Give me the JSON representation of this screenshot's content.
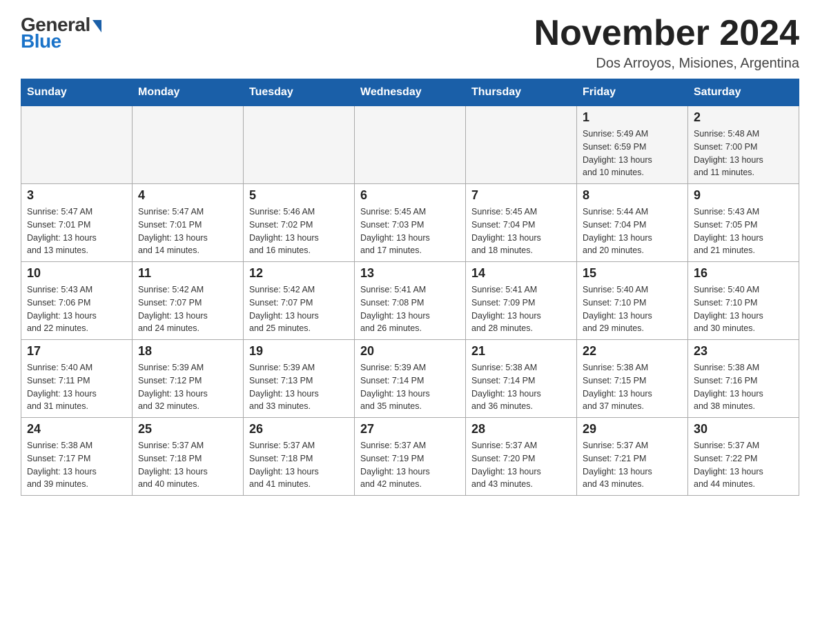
{
  "logo": {
    "general": "General",
    "blue": "Blue"
  },
  "header": {
    "month_year": "November 2024",
    "location": "Dos Arroyos, Misiones, Argentina"
  },
  "days_of_week": [
    "Sunday",
    "Monday",
    "Tuesday",
    "Wednesday",
    "Thursday",
    "Friday",
    "Saturday"
  ],
  "weeks": [
    {
      "days": [
        {
          "number": "",
          "info": ""
        },
        {
          "number": "",
          "info": ""
        },
        {
          "number": "",
          "info": ""
        },
        {
          "number": "",
          "info": ""
        },
        {
          "number": "",
          "info": ""
        },
        {
          "number": "1",
          "info": "Sunrise: 5:49 AM\nSunset: 6:59 PM\nDaylight: 13 hours\nand 10 minutes."
        },
        {
          "number": "2",
          "info": "Sunrise: 5:48 AM\nSunset: 7:00 PM\nDaylight: 13 hours\nand 11 minutes."
        }
      ]
    },
    {
      "days": [
        {
          "number": "3",
          "info": "Sunrise: 5:47 AM\nSunset: 7:01 PM\nDaylight: 13 hours\nand 13 minutes."
        },
        {
          "number": "4",
          "info": "Sunrise: 5:47 AM\nSunset: 7:01 PM\nDaylight: 13 hours\nand 14 minutes."
        },
        {
          "number": "5",
          "info": "Sunrise: 5:46 AM\nSunset: 7:02 PM\nDaylight: 13 hours\nand 16 minutes."
        },
        {
          "number": "6",
          "info": "Sunrise: 5:45 AM\nSunset: 7:03 PM\nDaylight: 13 hours\nand 17 minutes."
        },
        {
          "number": "7",
          "info": "Sunrise: 5:45 AM\nSunset: 7:04 PM\nDaylight: 13 hours\nand 18 minutes."
        },
        {
          "number": "8",
          "info": "Sunrise: 5:44 AM\nSunset: 7:04 PM\nDaylight: 13 hours\nand 20 minutes."
        },
        {
          "number": "9",
          "info": "Sunrise: 5:43 AM\nSunset: 7:05 PM\nDaylight: 13 hours\nand 21 minutes."
        }
      ]
    },
    {
      "days": [
        {
          "number": "10",
          "info": "Sunrise: 5:43 AM\nSunset: 7:06 PM\nDaylight: 13 hours\nand 22 minutes."
        },
        {
          "number": "11",
          "info": "Sunrise: 5:42 AM\nSunset: 7:07 PM\nDaylight: 13 hours\nand 24 minutes."
        },
        {
          "number": "12",
          "info": "Sunrise: 5:42 AM\nSunset: 7:07 PM\nDaylight: 13 hours\nand 25 minutes."
        },
        {
          "number": "13",
          "info": "Sunrise: 5:41 AM\nSunset: 7:08 PM\nDaylight: 13 hours\nand 26 minutes."
        },
        {
          "number": "14",
          "info": "Sunrise: 5:41 AM\nSunset: 7:09 PM\nDaylight: 13 hours\nand 28 minutes."
        },
        {
          "number": "15",
          "info": "Sunrise: 5:40 AM\nSunset: 7:10 PM\nDaylight: 13 hours\nand 29 minutes."
        },
        {
          "number": "16",
          "info": "Sunrise: 5:40 AM\nSunset: 7:10 PM\nDaylight: 13 hours\nand 30 minutes."
        }
      ]
    },
    {
      "days": [
        {
          "number": "17",
          "info": "Sunrise: 5:40 AM\nSunset: 7:11 PM\nDaylight: 13 hours\nand 31 minutes."
        },
        {
          "number": "18",
          "info": "Sunrise: 5:39 AM\nSunset: 7:12 PM\nDaylight: 13 hours\nand 32 minutes."
        },
        {
          "number": "19",
          "info": "Sunrise: 5:39 AM\nSunset: 7:13 PM\nDaylight: 13 hours\nand 33 minutes."
        },
        {
          "number": "20",
          "info": "Sunrise: 5:39 AM\nSunset: 7:14 PM\nDaylight: 13 hours\nand 35 minutes."
        },
        {
          "number": "21",
          "info": "Sunrise: 5:38 AM\nSunset: 7:14 PM\nDaylight: 13 hours\nand 36 minutes."
        },
        {
          "number": "22",
          "info": "Sunrise: 5:38 AM\nSunset: 7:15 PM\nDaylight: 13 hours\nand 37 minutes."
        },
        {
          "number": "23",
          "info": "Sunrise: 5:38 AM\nSunset: 7:16 PM\nDaylight: 13 hours\nand 38 minutes."
        }
      ]
    },
    {
      "days": [
        {
          "number": "24",
          "info": "Sunrise: 5:38 AM\nSunset: 7:17 PM\nDaylight: 13 hours\nand 39 minutes."
        },
        {
          "number": "25",
          "info": "Sunrise: 5:37 AM\nSunset: 7:18 PM\nDaylight: 13 hours\nand 40 minutes."
        },
        {
          "number": "26",
          "info": "Sunrise: 5:37 AM\nSunset: 7:18 PM\nDaylight: 13 hours\nand 41 minutes."
        },
        {
          "number": "27",
          "info": "Sunrise: 5:37 AM\nSunset: 7:19 PM\nDaylight: 13 hours\nand 42 minutes."
        },
        {
          "number": "28",
          "info": "Sunrise: 5:37 AM\nSunset: 7:20 PM\nDaylight: 13 hours\nand 43 minutes."
        },
        {
          "number": "29",
          "info": "Sunrise: 5:37 AM\nSunset: 7:21 PM\nDaylight: 13 hours\nand 43 minutes."
        },
        {
          "number": "30",
          "info": "Sunrise: 5:37 AM\nSunset: 7:22 PM\nDaylight: 13 hours\nand 44 minutes."
        }
      ]
    }
  ]
}
